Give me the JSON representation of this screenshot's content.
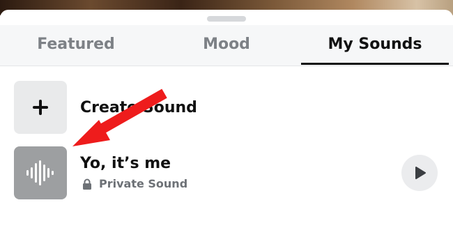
{
  "tabs": [
    {
      "label": "Featured",
      "active": false
    },
    {
      "label": "Mood",
      "active": false
    },
    {
      "label": "My Sounds",
      "active": true
    }
  ],
  "create_row": {
    "label": "Create Sound",
    "icon": "plus-icon"
  },
  "sound_row": {
    "title": "Yo, it’s me",
    "privacy_label": "Private Sound",
    "privacy_icon": "lock-icon",
    "tile_icon": "waveform-icon",
    "action_icon": "play-icon"
  },
  "annotation": {
    "icon": "arrow-icon",
    "color": "#ee1c1c"
  },
  "colors": {
    "active_tab": "#111111",
    "inactive_tab": "#7d8186",
    "accent_arrow": "#ee1c1c"
  }
}
